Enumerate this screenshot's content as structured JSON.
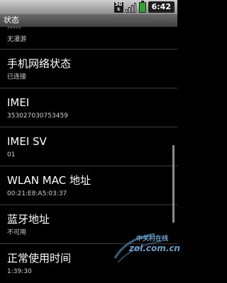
{
  "status_bar": {
    "network_type": "3G",
    "time": "6:42"
  },
  "title_bar": {
    "title": "状态"
  },
  "list": {
    "partial_top_peek": "*****",
    "partial_top_value": "无漫游",
    "items": [
      {
        "title": "手机网络状态",
        "value": "已连接"
      },
      {
        "title": "IMEI",
        "value": "353027030753459"
      },
      {
        "title": "IMEI SV",
        "value": "01"
      },
      {
        "title": "WLAN MAC 地址",
        "value": "00:21:E8:A5:03:37"
      },
      {
        "title": "蓝牙地址",
        "value": "不可用"
      },
      {
        "title": "正常使用时间",
        "value": "1:39:30"
      }
    ]
  },
  "watermark": {
    "top_text": "中关村在线",
    "main_text": "zol.com.cn"
  }
}
